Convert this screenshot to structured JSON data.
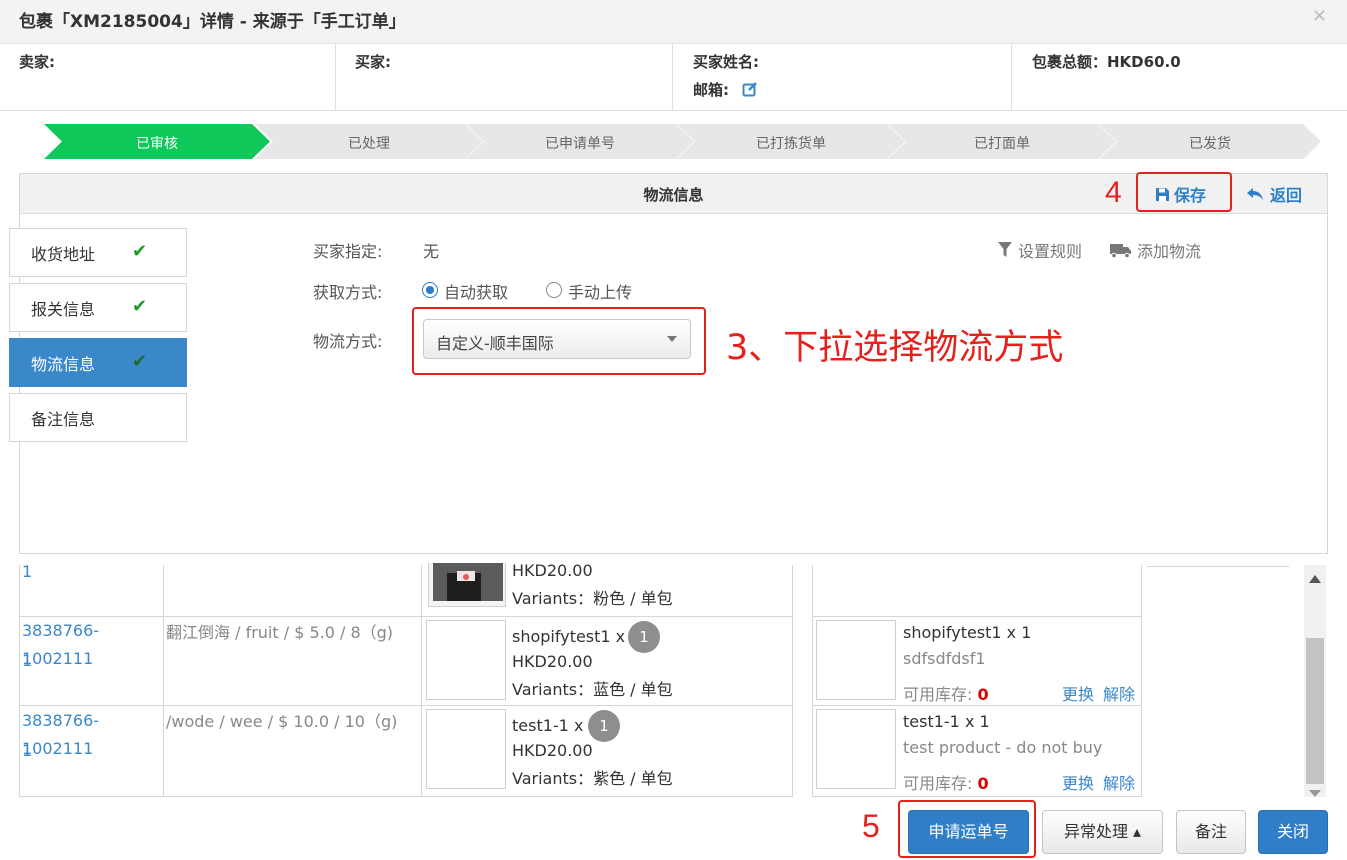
{
  "window": {
    "title": "包裹「XM2185004」详情 - 来源于「手工订单」",
    "close": "×"
  },
  "info": {
    "seller": "卖家:",
    "buyer": "买家:",
    "buyer_name": "买家姓名:",
    "email": "邮箱:",
    "total": "包裹总额：HKD60.0"
  },
  "steps": [
    "已审核",
    "已处理",
    "已申请单号",
    "已打拣货单",
    "已打面单",
    "已发货"
  ],
  "panel": {
    "title": "物流信息",
    "save": "保存",
    "back": "返回"
  },
  "side_tabs": [
    {
      "label": "收货地址",
      "check": "✔"
    },
    {
      "label": "报关信息",
      "check": "✔"
    },
    {
      "label": "物流信息",
      "check": "✔"
    },
    {
      "label": "备注信息"
    }
  ],
  "form": {
    "buyer_specified_label": "买家指定:",
    "buyer_specified_value": "无",
    "method_label": "获取方式:",
    "method_auto": "自动获取",
    "method_manual": "手动上传",
    "logistics_label": "物流方式:",
    "logistics_value": "自定义-顺丰国际",
    "set_rule": "设置规则",
    "add_logistics": "添加物流"
  },
  "annotations": {
    "step3": "3、下拉选择物流方式",
    "step4": "4",
    "step5": "5"
  },
  "partial_row": {
    "order_tail": "1",
    "price": "HKD20.00",
    "variants": "Variants：粉色 / 单包"
  },
  "rows": [
    {
      "order_line1": "3838766-1002111",
      "order_line2": "1",
      "desc": "翻江倒海 / fruit / $ 5.0 / 8（g)",
      "product": "shopifytest1 x",
      "qty": "1",
      "price": "HKD20.00",
      "variants": "Variants：蓝色 / 单包",
      "match_name": "shopifytest1 x 1",
      "match_desc": "sdfsdfdsf1",
      "stock_label": "可用库存:",
      "stock_value": "0",
      "replace": "更换",
      "release": "解除"
    },
    {
      "order_line1": "3838766-1002111",
      "order_line2": "1",
      "desc": "/wode / wee / $ 10.0 / 10（g)",
      "product": "test1-1 x",
      "qty": "1",
      "price": "HKD20.00",
      "variants": "Variants：紫色 / 单包",
      "match_name": "test1-1 x 1",
      "match_desc": "test product - do not buy",
      "stock_label": "可用库存:",
      "stock_value": "0",
      "replace": "更换",
      "release": "解除"
    }
  ],
  "buttons": {
    "apply": "申请运单号",
    "exception": "异常处理 ▴",
    "note": "备注",
    "close": "关闭"
  },
  "colors": {
    "accent_blue": "#2f7fc8",
    "step_green": "#0ec85a",
    "annotation_red": "#e4211c"
  }
}
